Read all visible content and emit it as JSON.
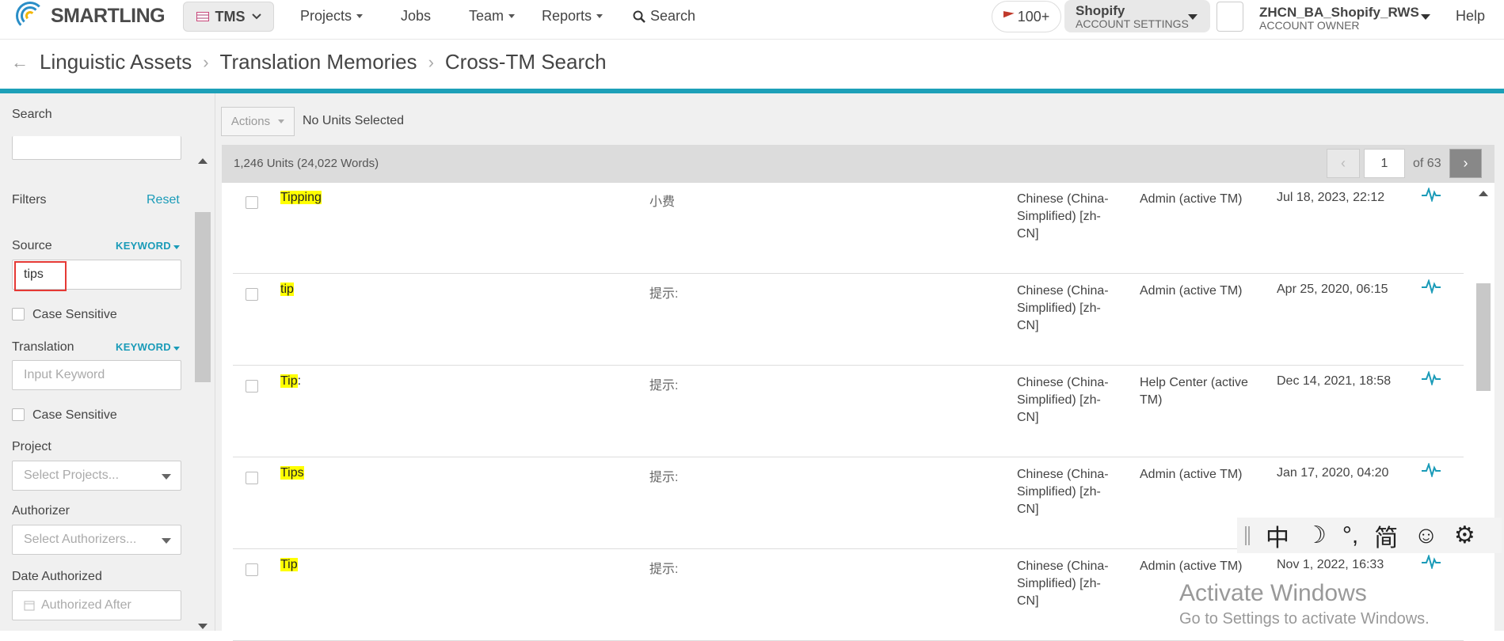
{
  "brand": {
    "name": "SMARTLING"
  },
  "topnav": {
    "product": "TMS",
    "items": [
      {
        "label": "Projects"
      },
      {
        "label": "Jobs"
      },
      {
        "label": "Team"
      },
      {
        "label": "Reports"
      },
      {
        "label": "Search"
      }
    ],
    "badge": "100+",
    "account": {
      "name": "Shopify",
      "sub": "ACCOUNT SETTINGS"
    },
    "user": {
      "name": "ZHCN_BA_Shopify_RWS",
      "role": "ACCOUNT OWNER"
    },
    "help": "Help"
  },
  "breadcrumb": [
    "Linguistic Assets",
    "Translation Memories",
    "Cross-TM Search"
  ],
  "sidebar": {
    "search_label": "Search",
    "filters_label": "Filters",
    "reset": "Reset",
    "source": {
      "label": "Source",
      "mode": "KEYWORD",
      "value": "tips",
      "case_label": "Case Sensitive"
    },
    "translation": {
      "label": "Translation",
      "mode": "KEYWORD",
      "placeholder": "Input Keyword",
      "case_label": "Case Sensitive"
    },
    "project": {
      "label": "Project",
      "placeholder": "Select Projects..."
    },
    "authorizer": {
      "label": "Authorizer",
      "placeholder": "Select Authorizers..."
    },
    "date": {
      "label": "Date Authorized",
      "placeholder": "Authorized After"
    }
  },
  "toolbar": {
    "actions": "Actions",
    "selection": "No Units Selected"
  },
  "summary": {
    "units": "1,246 Units (24,022 Words)",
    "page": "1",
    "of": "of 63"
  },
  "rows": [
    {
      "source": "Tipping",
      "source_rest": "",
      "target": "小费",
      "locale": "Chinese (China-Simplified) [zh-CN]",
      "tm": "Admin (active TM)",
      "date": "Jul 18, 2023, 22:12"
    },
    {
      "source": "tip",
      "source_rest": "",
      "target": "提示:",
      "locale": "Chinese (China-Simplified) [zh-CN]",
      "tm": "Admin (active TM)",
      "date": "Apr 25, 2020, 06:15"
    },
    {
      "source": "Tip",
      "source_rest": ":",
      "target": "提示:",
      "locale": "Chinese (China-Simplified) [zh-CN]",
      "tm": "Help Center (active TM)",
      "date": "Dec 14, 2021, 18:58"
    },
    {
      "source": "Tips",
      "source_rest": "",
      "target": "提示:",
      "locale": "Chinese (China-Simplified) [zh-CN]",
      "tm": "Admin (active TM)",
      "date": "Jan 17, 2020, 04:20"
    },
    {
      "source": "Tip",
      "source_rest": "",
      "target": "提示:",
      "locale": "Chinese (China-Simplified) [zh-CN]",
      "tm": "Admin (active TM)",
      "date": "Nov 1, 2022, 16:33"
    }
  ],
  "ime": {
    "chars": [
      "中",
      "☽",
      "°,",
      "简",
      "☺",
      "⚙"
    ]
  },
  "watermark": {
    "title": "Activate Windows",
    "sub": "Go to Settings to activate Windows."
  },
  "colors": {
    "accent": "#1da0b8",
    "highlight": "#ffff00",
    "link": "#1a9bb8"
  }
}
